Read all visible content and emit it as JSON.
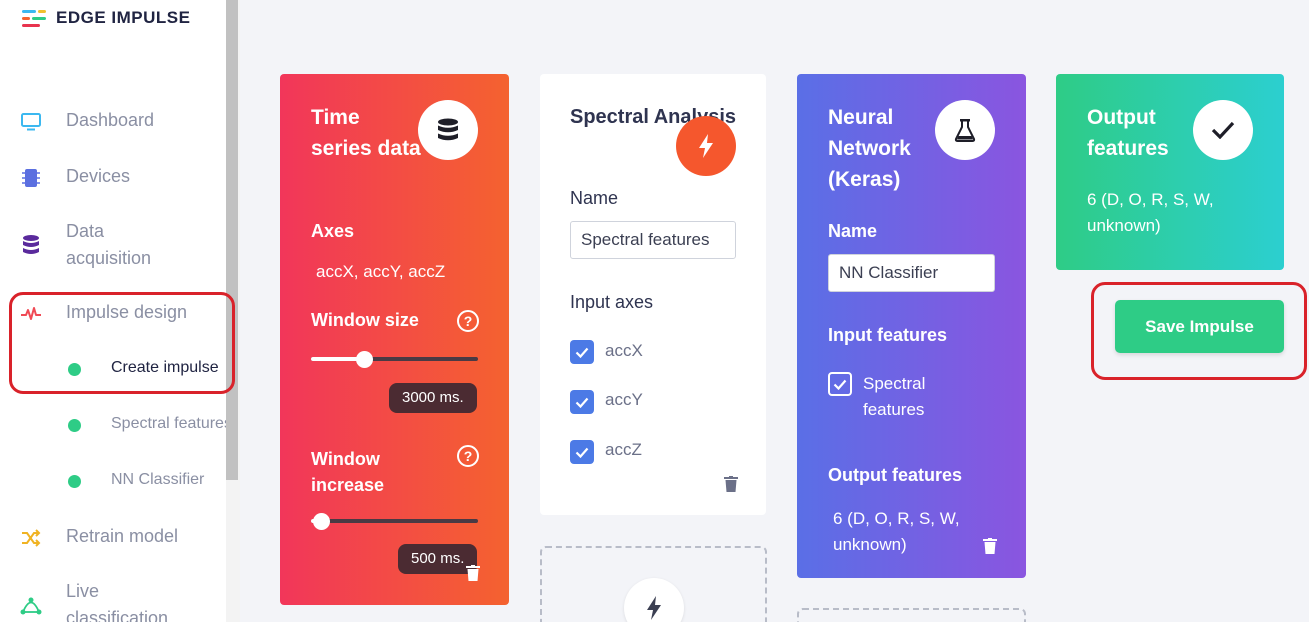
{
  "brand": {
    "name": "EDGE IMPULSE"
  },
  "sidebar": {
    "items": [
      {
        "label": "Dashboard",
        "icon": "monitor-icon"
      },
      {
        "label": "Devices",
        "icon": "chip-icon"
      },
      {
        "label": "Data acquisition",
        "icon": "database-icon"
      },
      {
        "label": "Impulse design",
        "icon": "pulse-icon"
      },
      {
        "label": "Retrain model",
        "icon": "shuffle-icon"
      },
      {
        "label": "Live classification",
        "icon": "network-icon"
      }
    ],
    "subitems": [
      {
        "label": "Create impulse"
      },
      {
        "label": "Spectral features"
      },
      {
        "label": "NN Classifier"
      }
    ]
  },
  "time_series": {
    "title": "Time series data",
    "axes_label": "Axes",
    "axes_value": "accX, accY, accZ",
    "window_size_label": "Window size",
    "window_size_value": "3000 ms.",
    "window_size_fraction": 0.32,
    "window_increase_label": "Window increase",
    "window_increase_value": "500 ms.",
    "window_increase_fraction": 0.06,
    "help_glyph": "?"
  },
  "spectral": {
    "title": "Spectral Analysis",
    "name_label": "Name",
    "name_value": "Spectral features",
    "input_axes_label": "Input axes",
    "axes": [
      "accX",
      "accY",
      "accZ"
    ]
  },
  "neural": {
    "title": "Neural Network (Keras)",
    "name_label": "Name",
    "name_value": "NN Classifier",
    "input_features_label": "Input features",
    "input_features_value": "Spectral features",
    "output_features_label": "Output features",
    "output_features_value": "6 (D, O, R, S, W, unknown)"
  },
  "output": {
    "title": "Output features",
    "value": "6 (D, O, R, S, W, unknown)"
  },
  "actions": {
    "save_label": "Save Impulse"
  },
  "colors": {
    "time_series_gradient": [
      "#f2365a",
      "#f4622f"
    ],
    "neural_gradient": [
      "#5a6fe6",
      "#8a55e0"
    ],
    "output_gradient": [
      "#2ecc86",
      "#2ccfd0"
    ],
    "spectral_icon": "#f5572d",
    "accent_green": "#2ecc86",
    "highlight_red": "#d9222a"
  }
}
